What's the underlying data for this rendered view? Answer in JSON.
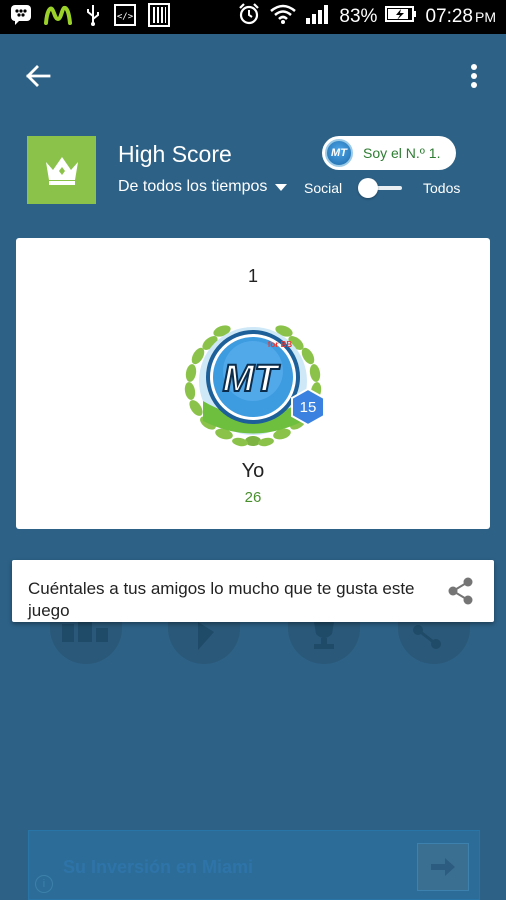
{
  "status_bar": {
    "battery": "83%",
    "time": "07:28",
    "ampm": "PM",
    "icons": [
      "bbm-icon",
      "movistar-icon",
      "usb-icon",
      "code-icon",
      "barcode-icon",
      "alarm-icon",
      "wifi-icon",
      "signal-icon",
      "battery-charging-icon"
    ]
  },
  "toolbar": {
    "back_icon": "arrow-back-icon",
    "overflow_icon": "more-vert-icon"
  },
  "leaderboard": {
    "title": "High Score",
    "time_filter": "De todos los tiempos",
    "rank_chip": "Soy el N.º 1.",
    "rank_chip_badge": "MT",
    "toggle_left": "Social",
    "toggle_right": "Todos"
  },
  "score_card": {
    "rank": "1",
    "player_name": "Yo",
    "player_score": "26",
    "player_level": "15",
    "badge_letters": "MT"
  },
  "share_toast": {
    "text": "Cuéntales a tus amigos lo mucho que te gusta este juego"
  },
  "ad": {
    "text": "Su Inversión en Miami",
    "info": "i"
  },
  "colors": {
    "app_bg": "#2d6186",
    "crown_tile": "#8bc34a",
    "score_green": "#4a8f2e",
    "level_hex": "#3b82e0"
  }
}
